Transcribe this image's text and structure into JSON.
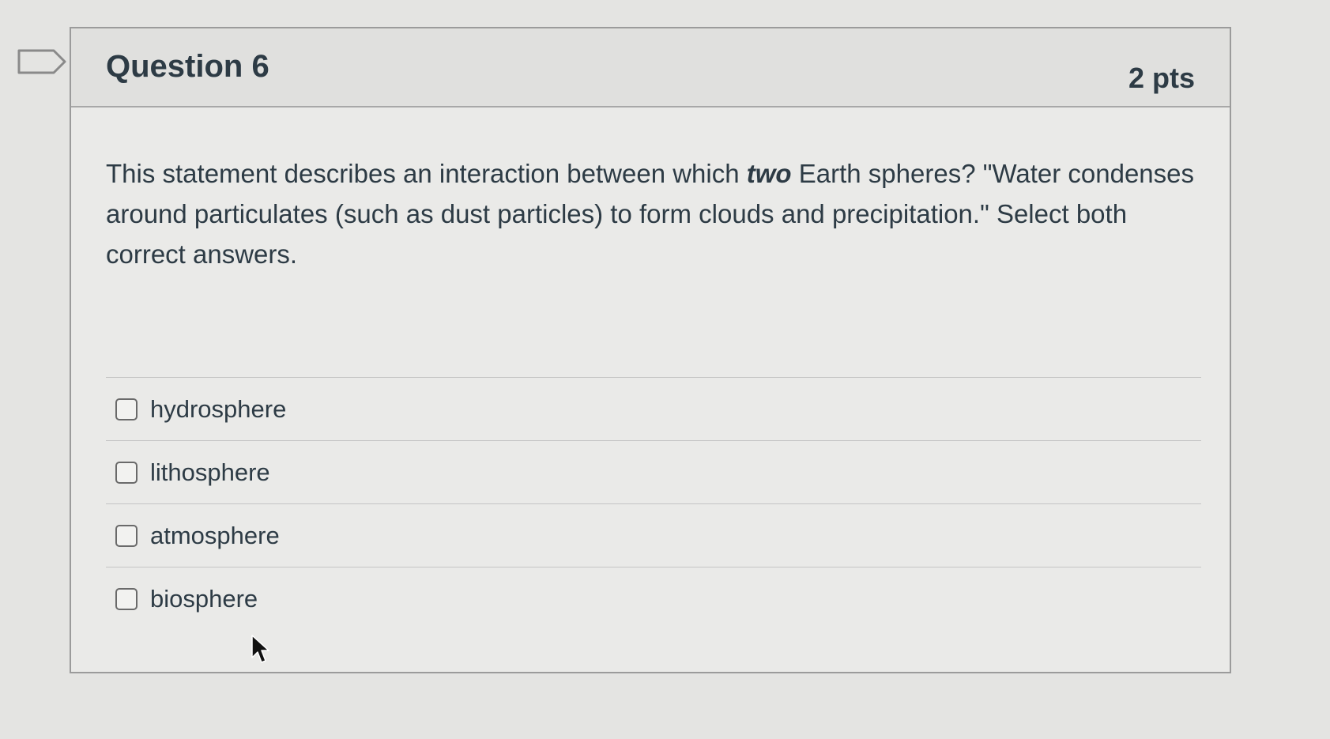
{
  "question": {
    "title": "Question 6",
    "points": "2 pts",
    "text_part1": "This statement describes an interaction between which ",
    "text_emphasis": "two",
    "text_part2": " Earth spheres? \"Water condenses around particulates (such as dust particles) to form clouds and precipitation.\" Select both correct answers.",
    "answers": [
      {
        "label": "hydrosphere",
        "checked": false
      },
      {
        "label": "lithosphere",
        "checked": false
      },
      {
        "label": "atmosphere",
        "checked": false
      },
      {
        "label": "biosphere",
        "checked": false
      }
    ]
  },
  "icons": {
    "flag": "flag-question-icon",
    "cursor": "mouse-pointer-icon"
  }
}
